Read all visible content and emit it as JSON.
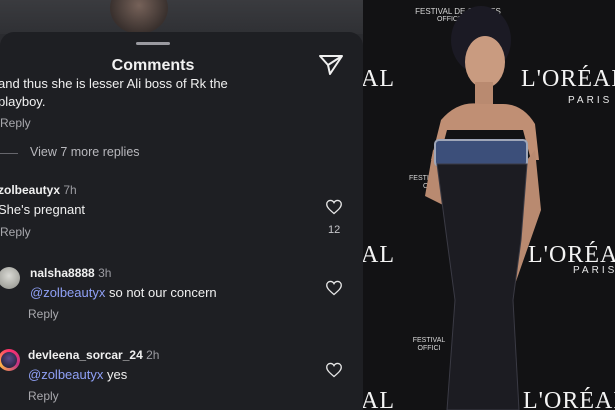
{
  "comments_panel": {
    "title": "Comments",
    "truncated_comment_line1": "and thus she is lesser Ali boss of Rk the",
    "truncated_comment_line2": "playboy.",
    "reply_label": "Reply",
    "view_more_replies": "View 7 more replies",
    "comments": [
      {
        "username": "zolbeautyx",
        "time": "7h",
        "text": "She's pregnant",
        "mention": "",
        "likes": "12"
      },
      {
        "username": "nalsha8888",
        "time": "3h",
        "mention": "@zolbeautyx",
        "text": " so not our concern",
        "likes": ""
      },
      {
        "username": "devleena_sorcar_24",
        "time": "2h",
        "mention": "@zolbeautyx",
        "text": " yes",
        "likes": ""
      }
    ]
  },
  "photo": {
    "festival_top": "FESTIVAL DE CANNES",
    "festival_top_sub": "OFFICIAL PA",
    "festival_mid": "FESTIVAL DE",
    "festival_mid_sub": "OFFI",
    "festival_bot": "FESTIVAL",
    "festival_bot_sub": "OFFICI",
    "brand": "L'ORÉAL",
    "brand_sub": "PARIS",
    "left_edge_fragment": "AL"
  },
  "colors": {
    "mention": "#8fa0f6",
    "panel_bg": "#1e1f23"
  }
}
